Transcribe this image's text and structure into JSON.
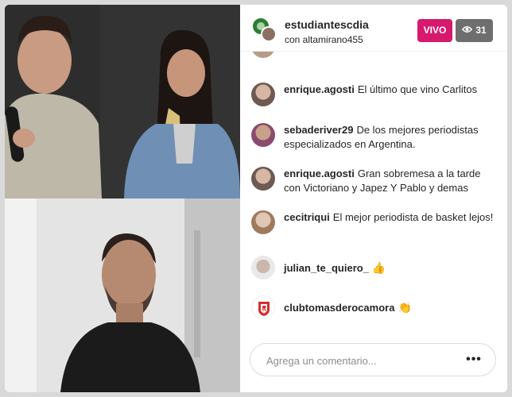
{
  "header": {
    "host_username": "estudiantescdia",
    "with_label": "con altamirano455",
    "live_label": "VIVO",
    "viewer_count": "31"
  },
  "comments": [
    {
      "user": "enrique.agosti",
      "text": "El último que vino Carlitos",
      "emoji": ""
    },
    {
      "user": "sebaderiver29",
      "text": "De los mejores periodistas especializados en Argentina.",
      "emoji": ""
    },
    {
      "user": "enrique.agosti",
      "text": "Gran sobremesa a la tarde con Victoriano y Japez Y Pablo y demas",
      "emoji": ""
    },
    {
      "user": "cecitriqui",
      "text": "El mejor periodista de basket lejos!",
      "emoji": ""
    },
    {
      "user": "julian_te_quiero_",
      "text": "",
      "emoji": "👍"
    },
    {
      "user": "clubtomasderocamora",
      "text": "",
      "emoji": "👏"
    }
  ],
  "footer": {
    "comment_placeholder": "Agrega un comentario...",
    "more_label": "•••"
  },
  "colors": {
    "live_badge": "#d6196d",
    "viewer_badge": "#6e6e6e",
    "text": "#262626",
    "placeholder": "#8e8e8e"
  },
  "icons": {
    "viewers": "eye-icon",
    "more": "more-options-icon",
    "like": "thumbs-up-emoji",
    "clap": "clapping-hands-emoji"
  }
}
